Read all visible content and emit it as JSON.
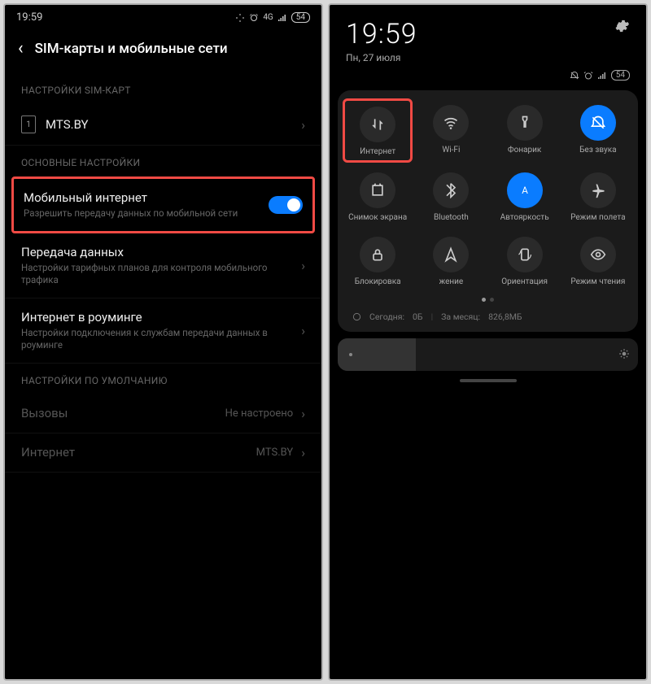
{
  "phone1": {
    "statusbar": {
      "time": "19:59",
      "net": "4G",
      "battery": "54"
    },
    "header": {
      "title": "SIM-карты и мобильные сети"
    },
    "sec_sim": "НАСТРОЙКИ SIM-КАРТ",
    "sim": {
      "slot": "1",
      "name": "MTS.BY"
    },
    "sec_main": "ОСНОВНЫЕ НАСТРОЙКИ",
    "mobile_data": {
      "label": "Мобильный интернет",
      "sub": "Разрешить передачу данных по мобильной сети"
    },
    "data_usage": {
      "label": "Передача данных",
      "sub": "Настройки тарифных планов для контроля мобильного трафика"
    },
    "roaming": {
      "label": "Интернет в роуминге",
      "sub": "Настройки подключения к службам передачи данных в роуминге"
    },
    "sec_default": "НАСТРОЙКИ ПО УМОЛЧАНИЮ",
    "calls": {
      "label": "Вызовы",
      "val": "Не настроено"
    },
    "internet": {
      "label": "Интернет",
      "val": "MTS.BY"
    }
  },
  "phone2": {
    "clock": "19:59",
    "date": "Пн, 27 июля",
    "battery": "54",
    "tiles": [
      {
        "key": "data",
        "label": "Интернет",
        "on": false
      },
      {
        "key": "wifi",
        "label": "Wi-Fi",
        "on": false
      },
      {
        "key": "torch",
        "label": "Фонарик",
        "on": false
      },
      {
        "key": "dnd",
        "label": "Без звука",
        "on": true
      },
      {
        "key": "screenshot",
        "label": "Снимок экрана",
        "on": false
      },
      {
        "key": "bt",
        "label": "Bluetooth",
        "on": false
      },
      {
        "key": "autobright",
        "label": "Автояркость",
        "on": true
      },
      {
        "key": "airplane",
        "label": "Режим полета",
        "on": false
      },
      {
        "key": "lock",
        "label": "Блокировка",
        "on": false
      },
      {
        "key": "nav",
        "label": "жение",
        "on": false
      },
      {
        "key": "orient",
        "label": "Ориентация",
        "on": false
      },
      {
        "key": "read",
        "label": "Режим чтения",
        "on": false
      }
    ],
    "usage": {
      "today_lbl": "Сегодня:",
      "today_val": "0Б",
      "month_lbl": "За месяц:",
      "month_val": "826,8МБ"
    }
  }
}
